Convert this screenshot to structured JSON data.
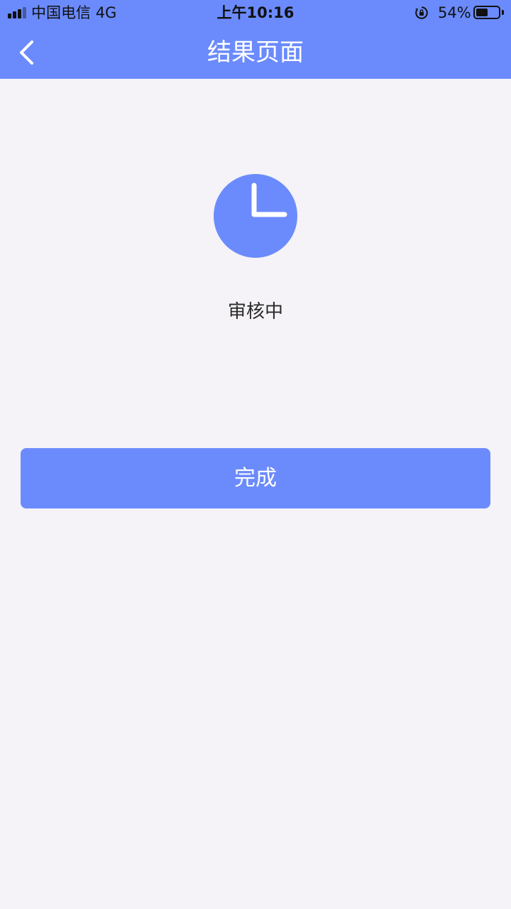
{
  "status_bar": {
    "carrier": "中国电信",
    "network": "4G",
    "time": "上午10:16",
    "battery_percent": "54%",
    "battery_level": 0.54,
    "icons": [
      "signal-icon",
      "rotation-lock-icon",
      "battery-icon"
    ]
  },
  "nav": {
    "title": "结果页面",
    "back_icon": "chevron-left-icon"
  },
  "result": {
    "icon": "clock-icon",
    "status_text": "审核中"
  },
  "actions": {
    "done_label": "完成"
  },
  "colors": {
    "primary": "#6b8bfd",
    "background": "#f5f3f7",
    "text_dark": "#2b2b2b",
    "on_primary": "#ffffff"
  }
}
